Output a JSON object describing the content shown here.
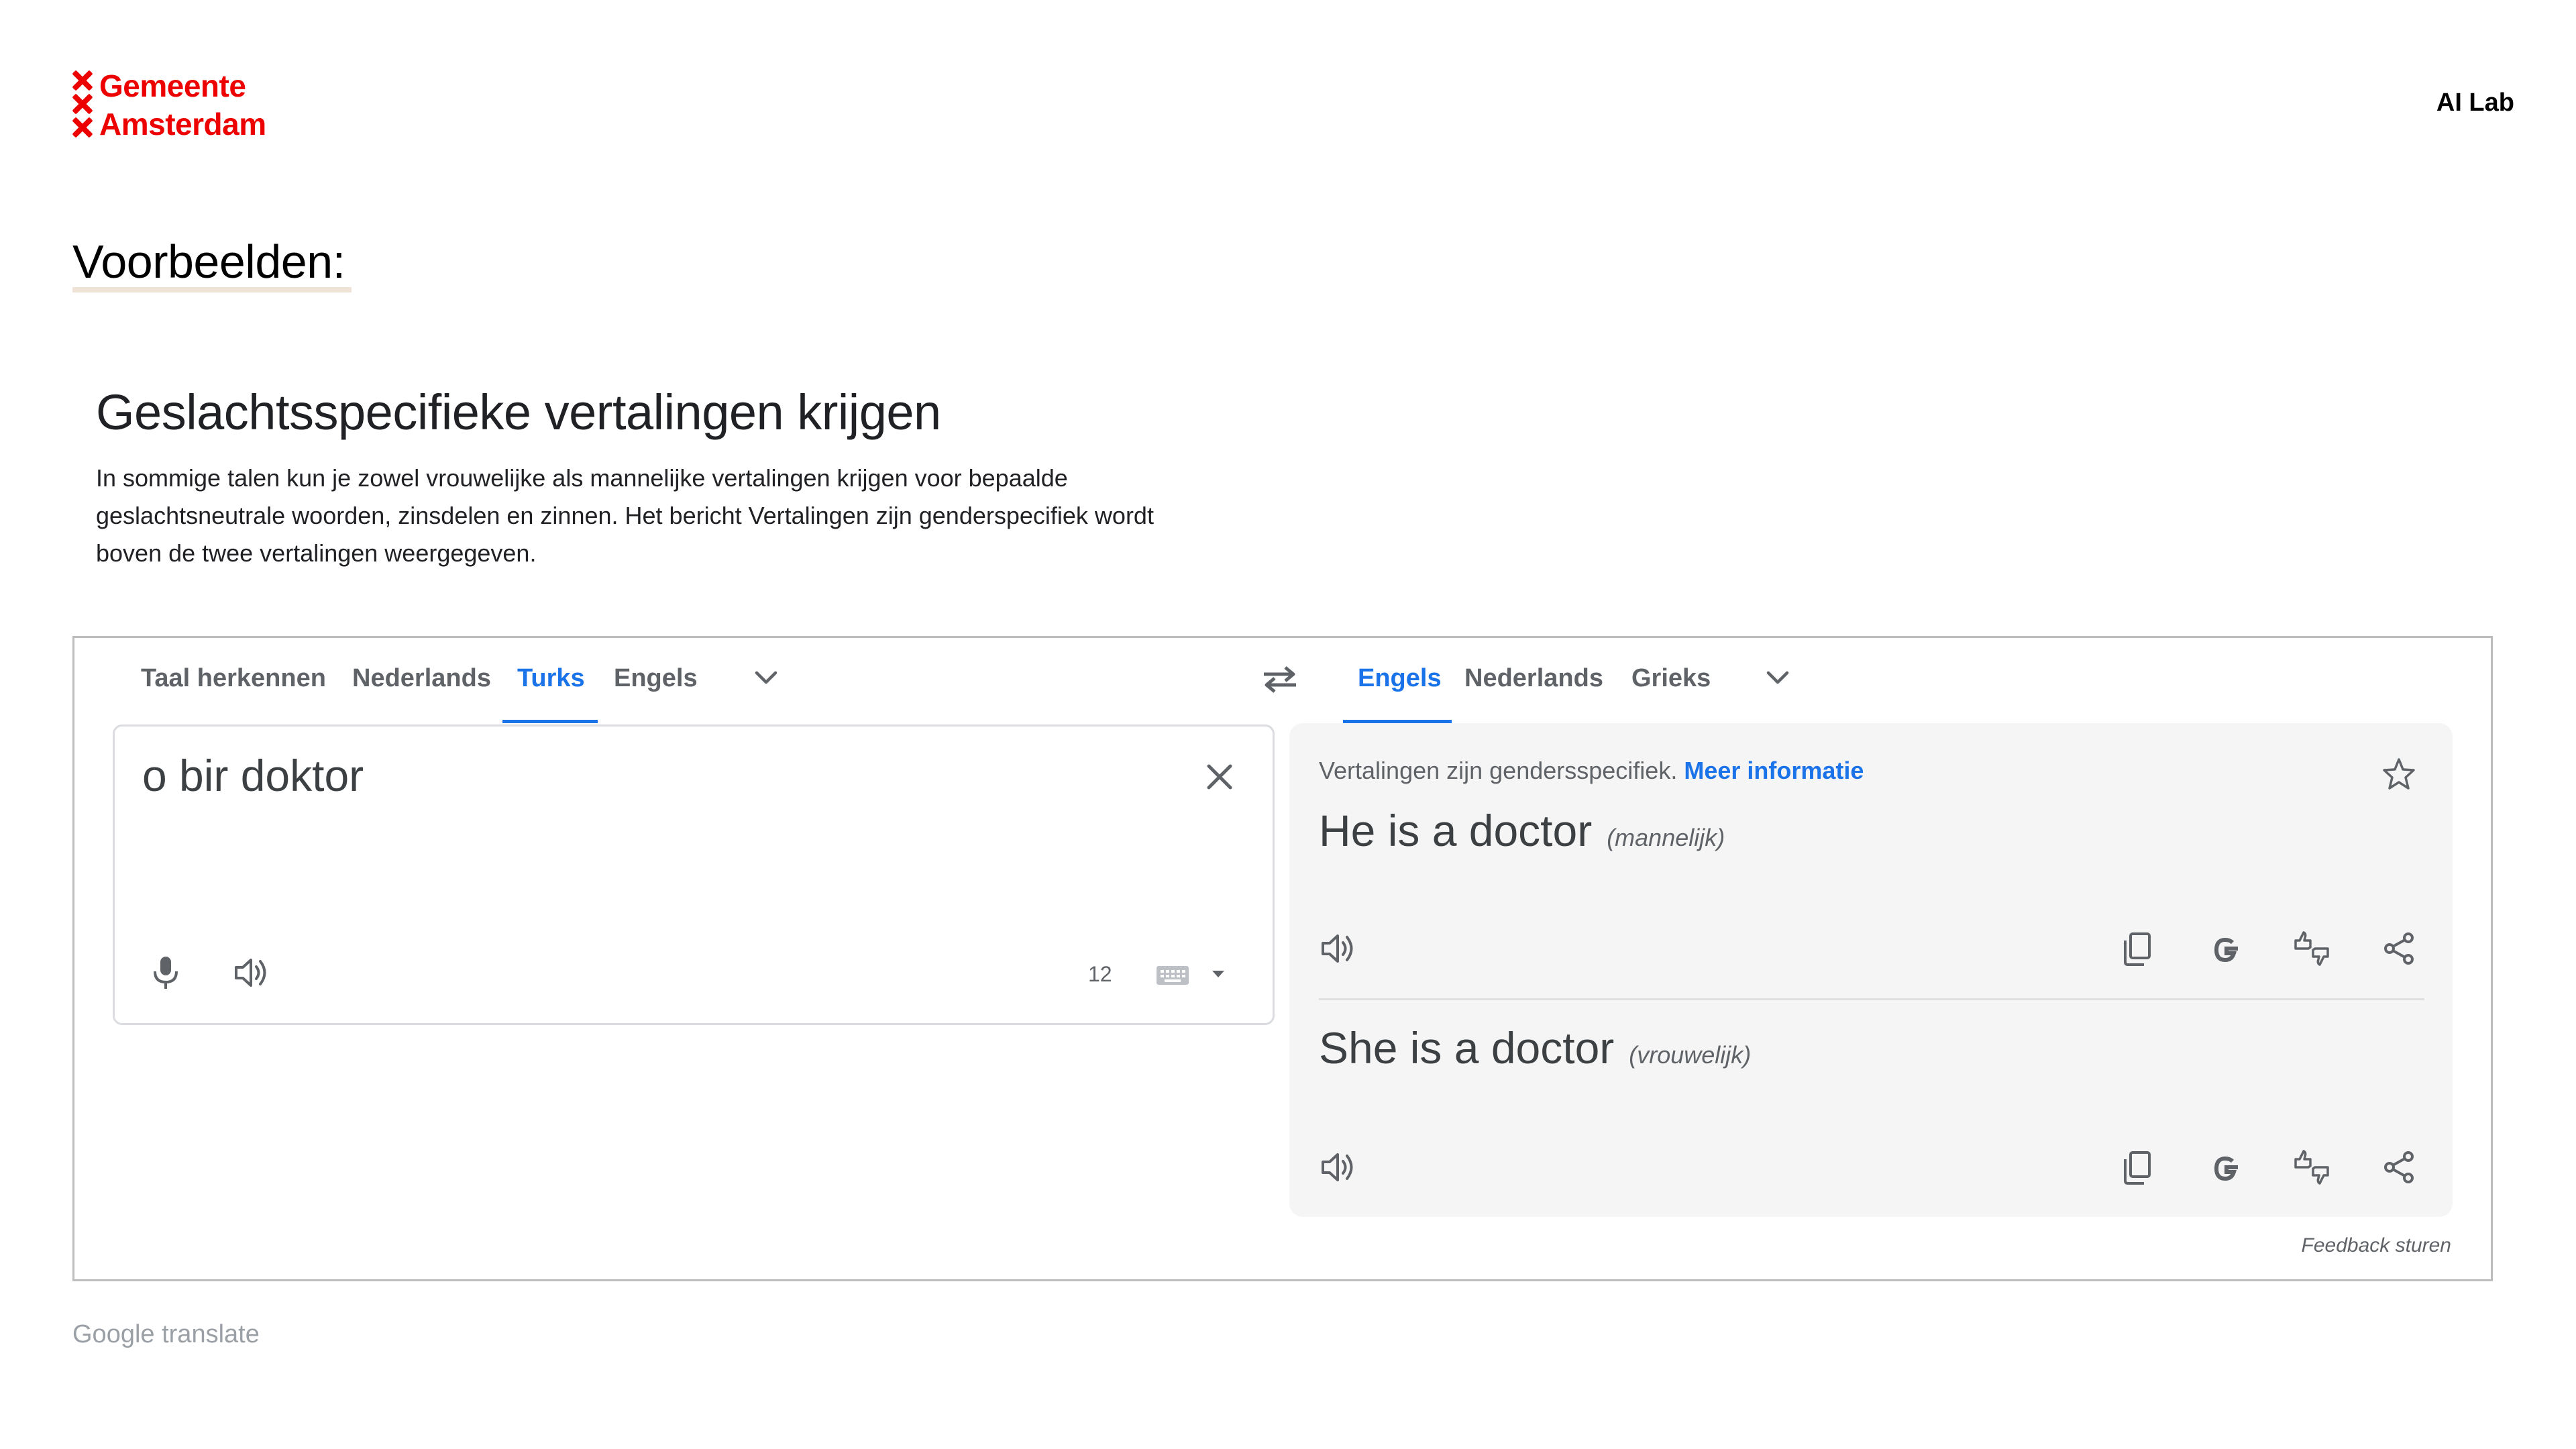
{
  "header": {
    "logo_line1": "Gemeente",
    "logo_line2": "Amsterdam",
    "right_label": "AI Lab"
  },
  "slide": {
    "title": "Voorbeelden:",
    "heading": "Geslachtsspecifieke vertalingen krijgen",
    "description": "In sommige talen kun je zowel vrouwelijke als mannelijke vertalingen krijgen voor bepaalde geslachtsneutrale woorden, zinsdelen en zinnen. Het bericht Vertalingen zijn genderspecifiek wordt boven de twee vertalingen weergegeven.",
    "caption": "Google translate"
  },
  "translate": {
    "source_tabs": [
      "Taal herkennen",
      "Nederlands",
      "Turks",
      "Engels"
    ],
    "source_active_index": 2,
    "target_tabs": [
      "Engels",
      "Nederlands",
      "Grieks"
    ],
    "target_active_index": 0,
    "source_text": "o bir doktor",
    "char_count": "12",
    "gender_note": "Vertalingen zijn gendersspecifiek.",
    "more_info_link": "Meer informatie",
    "translations": [
      {
        "text": "He is a doctor",
        "gender": "(mannelijk)"
      },
      {
        "text": "She is a doctor",
        "gender": "(vrouwelijk)"
      }
    ],
    "feedback": "Feedback sturen",
    "colors": {
      "accent": "#1a73e8",
      "brand_red": "#ec0000",
      "panel_bg": "#f5f5f5"
    },
    "icons": [
      "swap-icon",
      "chevron-down-icon",
      "close-icon",
      "microphone-icon",
      "speaker-icon",
      "keyboard-icon",
      "star-icon",
      "copy-icon",
      "google-icon",
      "rate-icon",
      "share-icon"
    ]
  }
}
